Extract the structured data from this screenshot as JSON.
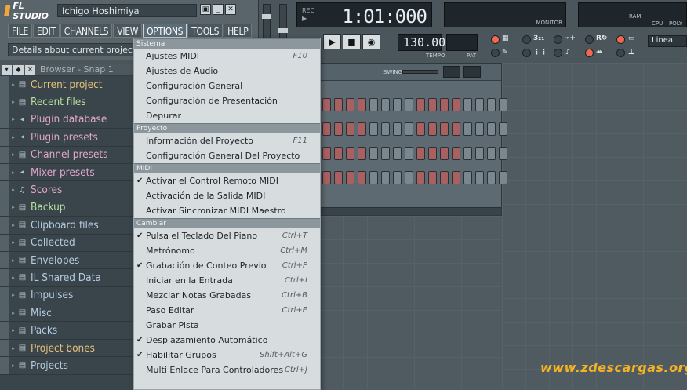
{
  "app": {
    "logo": "FL STUDIO",
    "song_name": "Ichigo Hoshimiya",
    "hint": "Details about current project"
  },
  "window_buttons": [
    "▣",
    "_",
    "✕"
  ],
  "menubar": [
    "FILE",
    "EDIT",
    "CHANNELS",
    "VIEW",
    "OPTIONS",
    "TOOLS",
    "HELP"
  ],
  "transport": {
    "time": "1:01:000",
    "time_icons": [
      "REC",
      "▶"
    ],
    "tempo": "130.000",
    "tempo_label": "TEMPO",
    "pat_label": "PAT",
    "monitor_label": "MONITOR",
    "ram_label": "RAM",
    "cpu_label": "CPU",
    "poly_label": "POLY",
    "snap_value": "Linea"
  },
  "browser": {
    "title": "Browser - Snap 1",
    "items": [
      {
        "label": "Current project",
        "color": "gold",
        "icon": "▤"
      },
      {
        "label": "Recent files",
        "color": "green",
        "icon": "▤"
      },
      {
        "label": "Plugin database",
        "color": "pink",
        "icon": "◂"
      },
      {
        "label": "Plugin presets",
        "color": "pink",
        "icon": "◂"
      },
      {
        "label": "Channel presets",
        "color": "pink",
        "icon": "▤"
      },
      {
        "label": "Mixer presets",
        "color": "pink",
        "icon": "◂"
      },
      {
        "label": "Scores",
        "color": "pink",
        "icon": "♫"
      },
      {
        "label": "Backup",
        "color": "green",
        "icon": "▤"
      },
      {
        "label": "Clipboard files",
        "color": "blue",
        "icon": "▤"
      },
      {
        "label": "Collected",
        "color": "blue",
        "icon": "▤"
      },
      {
        "label": "Envelopes",
        "color": "blue",
        "icon": "▤"
      },
      {
        "label": "IL Shared Data",
        "color": "blue",
        "icon": "▤"
      },
      {
        "label": "Impulses",
        "color": "blue",
        "icon": "▤"
      },
      {
        "label": "Misc",
        "color": "blue",
        "icon": "▤"
      },
      {
        "label": "Packs",
        "color": "blue",
        "icon": "▤"
      },
      {
        "label": "Project bones",
        "color": "gold",
        "icon": "▤"
      },
      {
        "label": "Projects",
        "color": "blue",
        "icon": "▤"
      }
    ]
  },
  "sequencer": {
    "swing_label": "SWING",
    "rows": 4,
    "steps_per_row": 16
  },
  "options_menu": {
    "sections": [
      {
        "title": "Sistema",
        "items": [
          {
            "label": "Ajustes MIDI",
            "shortcut": "F10",
            "checked": false
          },
          {
            "label": "Ajustes de Audio",
            "shortcut": "",
            "checked": false
          },
          {
            "label": "Configuración General",
            "shortcut": "",
            "checked": false
          },
          {
            "label": "Configuración de Presentación",
            "shortcut": "",
            "checked": false
          },
          {
            "label": "Depurar",
            "shortcut": "",
            "checked": false
          }
        ]
      },
      {
        "title": "Proyecto",
        "items": [
          {
            "label": "Información del Proyecto",
            "shortcut": "F11",
            "checked": false
          },
          {
            "label": "Configuración General Del Proyecto",
            "shortcut": "",
            "checked": false
          }
        ]
      },
      {
        "title": "MIDI",
        "items": [
          {
            "label": "Activar el Control Remoto MIDI",
            "shortcut": "",
            "checked": true
          },
          {
            "label": "Activación de la Salida MIDI",
            "shortcut": "",
            "checked": false
          },
          {
            "label": "Activar Sincronizar MIDI Maestro",
            "shortcut": "",
            "checked": false
          }
        ]
      },
      {
        "title": "Cambiar",
        "items": [
          {
            "label": "Pulsa el Teclado Del Piano",
            "shortcut": "Ctrl+T",
            "checked": true
          },
          {
            "label": "Metrónomo",
            "shortcut": "Ctrl+M",
            "checked": false
          },
          {
            "label": "Grabación de Conteo Previo",
            "shortcut": "Ctrl+P",
            "checked": true
          },
          {
            "label": "Iniciar en la Entrada",
            "shortcut": "Ctrl+I",
            "checked": false
          },
          {
            "label": "Mezclar Notas Grabadas",
            "shortcut": "Ctrl+B",
            "checked": false
          },
          {
            "label": "Paso Editar",
            "shortcut": "Ctrl+E",
            "checked": false
          },
          {
            "label": "Grabar Pista",
            "shortcut": "",
            "checked": false
          },
          {
            "label": "Desplazamiento Automático",
            "shortcut": "",
            "checked": true
          },
          {
            "label": "Habilitar Grupos",
            "shortcut": "Shift+Alt+G",
            "checked": true
          },
          {
            "label": "Multi Enlace Para Controladores",
            "shortcut": "Ctrl+J",
            "checked": false
          }
        ]
      }
    ]
  },
  "watermark": "www.zdescargas.org",
  "colors": {
    "accent_red": "#f16a50",
    "step_red": "#a86060",
    "watermark": "#f5b324",
    "menu_bg": "#d7dcdf"
  }
}
